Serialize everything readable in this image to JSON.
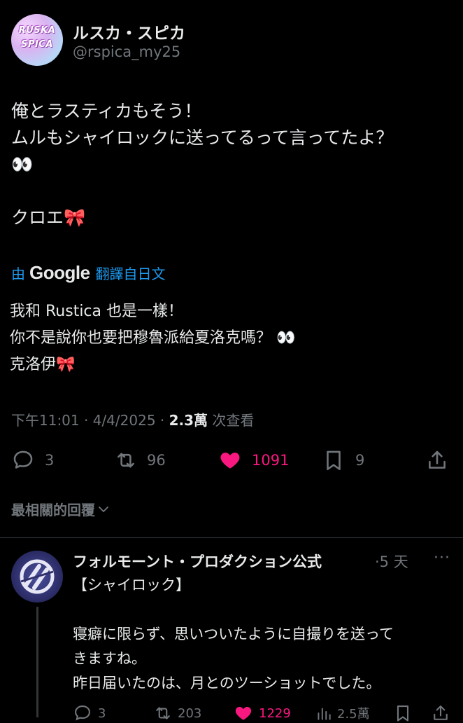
{
  "post": {
    "display_name": "ルスカ・スピカ",
    "handle": "@rspica_my25",
    "avatar_text_line1": "RUSKA",
    "avatar_text_line2": "SPICA",
    "text": "俺とラスティカもそう！\nムルもシャイロックに送ってるって言ってたよ？\n👀\n\nクロエ🎀",
    "translation": {
      "by": "由",
      "brand": "Google",
      "label": "翻譯自日文",
      "text": "我和 Rustica 也是一樣！\n你不是說你也要把穆魯派給夏洛克嗎？ 👀\n克洛伊🎀"
    },
    "meta": {
      "time": "下午11:01",
      "sep1": " · ",
      "date": "4/4/2025",
      "sep2": " · ",
      "views_count": "2.3萬",
      "views_label": " 次查看"
    },
    "actions": {
      "replies": "3",
      "reposts": "96",
      "likes": "1091",
      "bookmarks": "9"
    }
  },
  "sort": {
    "label": "最相關的回覆"
  },
  "reply": {
    "display_name": "フォルモーント・プロダクション公式",
    "time": "·5 天",
    "more": "···",
    "text": "【シャイロック】\n\n寝癖に限らず、思いついたように自撮りを送って\nきますね。\n昨日届いたのは、月とのツーショットでした。",
    "actions": {
      "replies": "3",
      "reposts": "203",
      "likes": "1229",
      "views": "2.5萬"
    }
  },
  "colors": {
    "accent": "#1d9bf0",
    "like": "#f91880",
    "muted": "#71767b",
    "text": "#e7e9ea",
    "background": "#000000"
  }
}
